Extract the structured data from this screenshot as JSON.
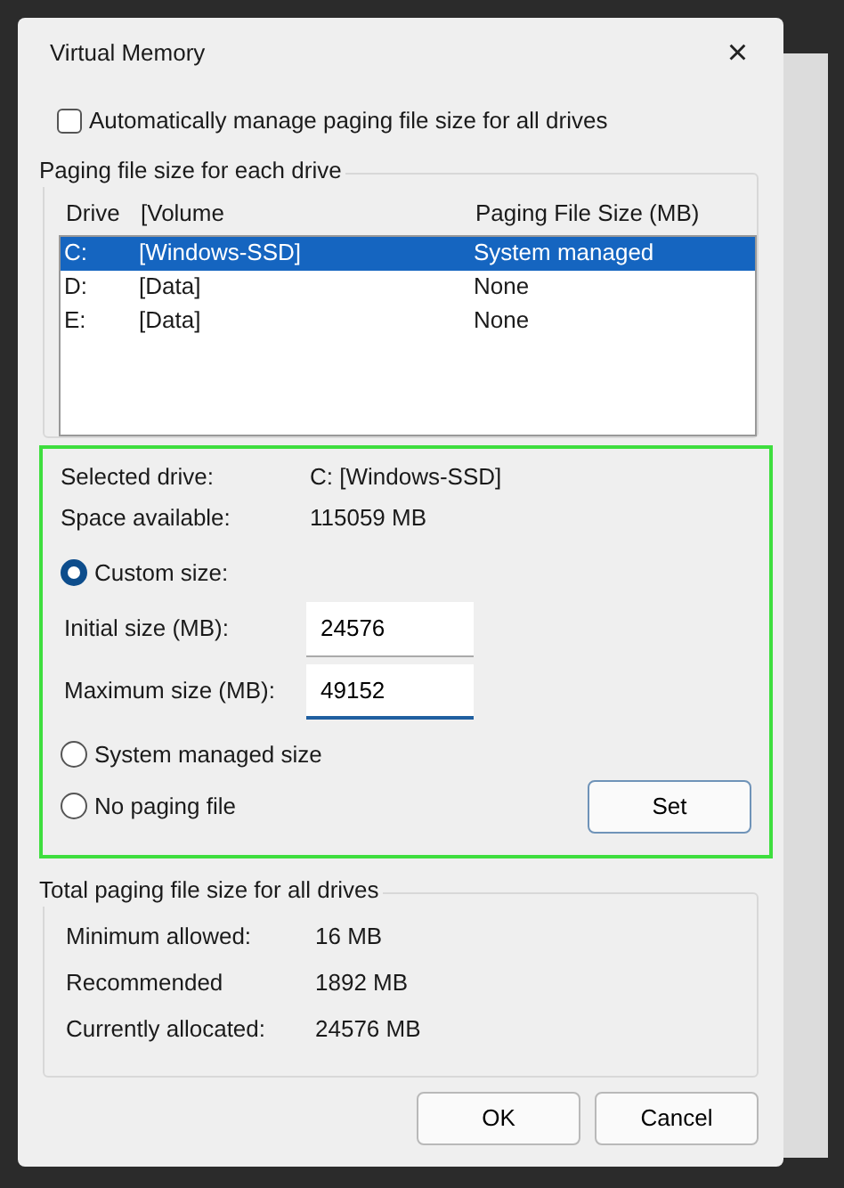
{
  "window": {
    "title": "Virtual Memory",
    "close": "×"
  },
  "auto_manage": {
    "label": "Automatically manage paging file size for all drives",
    "checked": false
  },
  "drive_group": {
    "title": "Paging file size for each drive",
    "columns": [
      "Drive",
      "[Volume",
      "Paging File Size (MB)"
    ],
    "rows": [
      {
        "drive": "C:",
        "volume": "[Windows-SSD]",
        "size": "System managed",
        "selected": true
      },
      {
        "drive": "D:",
        "volume": "[Data]",
        "size": "None",
        "selected": false
      },
      {
        "drive": "E:",
        "volume": "[Data]",
        "size": "None",
        "selected": false
      }
    ]
  },
  "selected_info": [
    {
      "label": "Selected drive:",
      "value": "C:  [Windows-SSD]"
    },
    {
      "label": "Space available:",
      "value": "115059 MB"
    }
  ],
  "options": [
    {
      "kind": "custom",
      "label": "Custom size:",
      "selected": true,
      "fields": [
        {
          "label": "Initial size (MB):",
          "value": "24576",
          "focused": false
        },
        {
          "label": "Maximum size (MB):",
          "value": "49152",
          "focused": true
        }
      ]
    },
    {
      "kind": "plain",
      "label": "System managed size",
      "selected": false
    },
    {
      "kind": "set",
      "label": "No paging file",
      "selected": false,
      "button": "Set"
    }
  ],
  "totals": {
    "title": "Total paging file size for all drives",
    "rows": [
      {
        "label": "Minimum allowed:",
        "value": "16 MB"
      },
      {
        "label": "Recommended",
        "value": "1892 MB"
      },
      {
        "label": "Currently allocated:",
        "value": "24576 MB"
      }
    ]
  },
  "buttons": [
    "OK",
    "Cancel"
  ]
}
